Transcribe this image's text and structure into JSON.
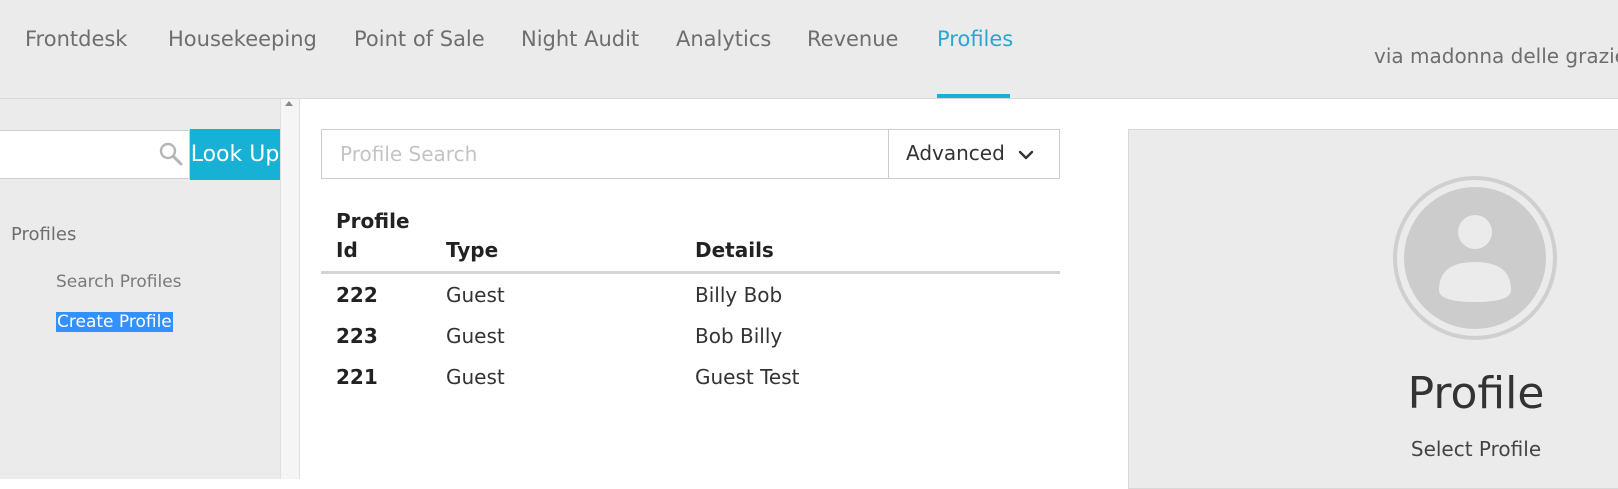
{
  "nav": {
    "items": [
      {
        "label": "Frontdesk"
      },
      {
        "label": "Housekeeping"
      },
      {
        "label": "Point of Sale"
      },
      {
        "label": "Night Audit"
      },
      {
        "label": "Analytics"
      },
      {
        "label": "Revenue"
      },
      {
        "label": "Profiles"
      }
    ],
    "active": "Profiles",
    "hotel_name": "via madonna delle grazie"
  },
  "sidebar": {
    "search": {
      "value": "",
      "placeholder": ""
    },
    "lookup_label": "Look Up",
    "heading": "Profiles",
    "links": [
      {
        "label": "Search Profiles",
        "selected": false
      },
      {
        "label": "Create Profile",
        "selected": true
      }
    ]
  },
  "search": {
    "placeholder": "Profile Search",
    "value": "",
    "advanced_label": "Advanced"
  },
  "results": {
    "headers": {
      "id_line1": "Profile",
      "id_line2": "Id",
      "type": "Type",
      "details": "Details"
    },
    "rows": [
      {
        "id": "222",
        "type": "Guest",
        "details": "Billy Bob"
      },
      {
        "id": "223",
        "type": "Guest",
        "details": "Bob Billy"
      },
      {
        "id": "221",
        "type": "Guest",
        "details": "Guest Test"
      }
    ]
  },
  "profile_panel": {
    "title": "Profile",
    "subtitle": "Select Profile"
  },
  "colors": {
    "accent": "#17b1d6",
    "active_nav": "#2aa6d3",
    "selection": "#3390ff",
    "nav_bg": "#ebebeb"
  },
  "icons": {
    "search": "search-icon",
    "chevron": "chevron-down-icon",
    "avatar": "user-avatar-icon"
  }
}
